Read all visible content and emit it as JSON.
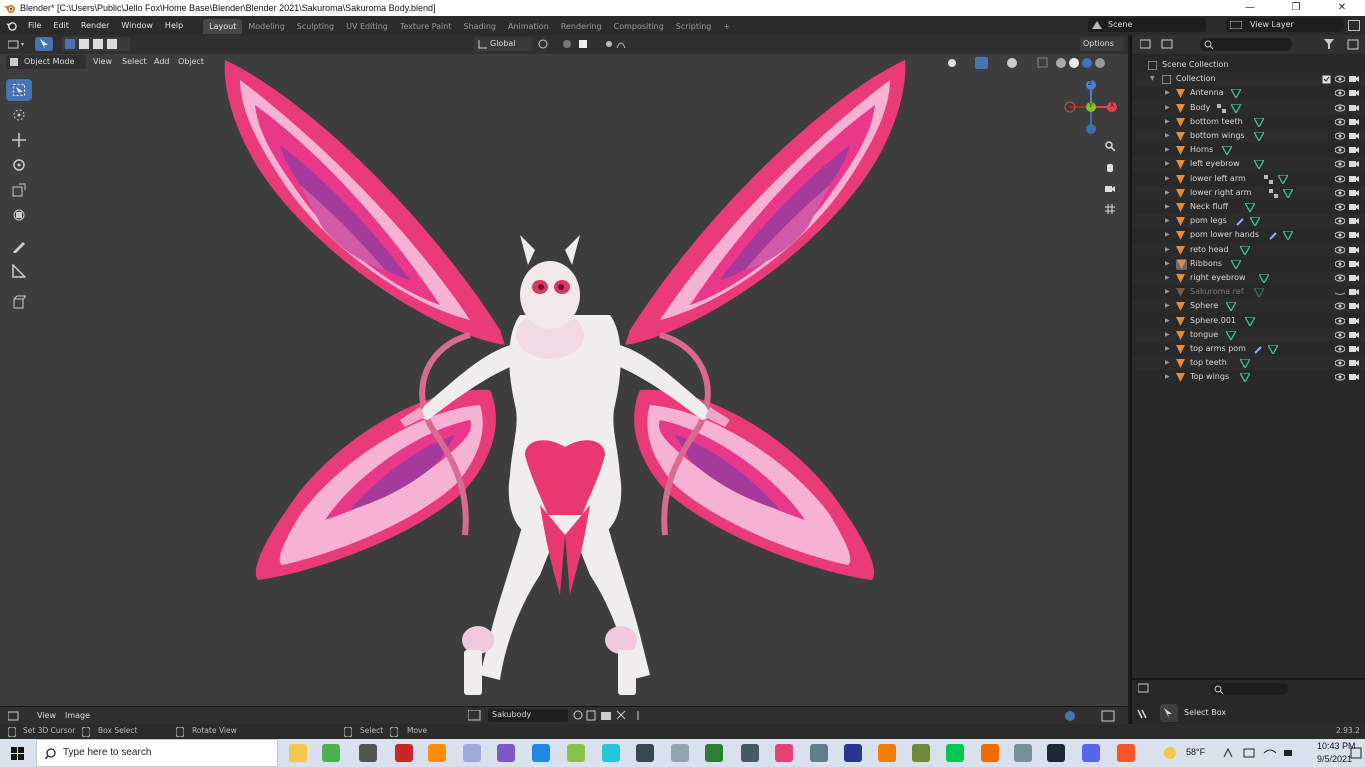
{
  "window": {
    "title": "Blender* [C:\\Users\\Public\\Jello Fox\\Home Base\\Blender\\Blender 2021\\Sakuroma\\Sakuroma Body.blend]",
    "minimize": "—",
    "restore": "❐",
    "close": "✕"
  },
  "menus": [
    "File",
    "Edit",
    "Render",
    "Window",
    "Help"
  ],
  "workspaces": [
    "Layout",
    "Modeling",
    "Sculpting",
    "UV Editing",
    "Texture Paint",
    "Shading",
    "Animation",
    "Rendering",
    "Compositing",
    "Scripting"
  ],
  "workspace_add": "+",
  "active_workspace": "Layout",
  "scene": {
    "label": "Scene",
    "view_layer": "View Layer"
  },
  "viewport": {
    "mode": "Object Mode",
    "menus": [
      "View",
      "Select",
      "Add",
      "Object"
    ],
    "orientation": "Global",
    "options": "Options",
    "gizmo_axes": {
      "x": "X",
      "y": "Y",
      "z": "Z"
    }
  },
  "outliner": {
    "root": "Scene Collection",
    "collection": "Collection",
    "items": [
      {
        "name": "Antenna",
        "dim": false,
        "mods": "none"
      },
      {
        "name": "Body",
        "dim": false,
        "mods": "armature"
      },
      {
        "name": "bottom teeth",
        "dim": false,
        "mods": "none"
      },
      {
        "name": "bottom wings",
        "dim": false,
        "mods": "none"
      },
      {
        "name": "Horns",
        "dim": false,
        "mods": "none"
      },
      {
        "name": "left eyebrow",
        "dim": false,
        "mods": "none"
      },
      {
        "name": "lower left arm",
        "dim": false,
        "mods": "armature"
      },
      {
        "name": "lower right arm",
        "dim": false,
        "mods": "armature"
      },
      {
        "name": "Neck fluff",
        "dim": false,
        "mods": "none"
      },
      {
        "name": "pom legs",
        "dim": false,
        "mods": "wrench"
      },
      {
        "name": "pom lower hands",
        "dim": false,
        "mods": "wrench"
      },
      {
        "name": "reto head",
        "dim": false,
        "mods": "none"
      },
      {
        "name": "Ribbons",
        "dim": false,
        "mods": "none"
      },
      {
        "name": "right eyebrow",
        "dim": false,
        "mods": "none"
      },
      {
        "name": "Sakuroma ref",
        "dim": true,
        "mods": "none"
      },
      {
        "name": "Sphere",
        "dim": false,
        "mods": "none"
      },
      {
        "name": "Sphere.001",
        "dim": false,
        "mods": "none"
      },
      {
        "name": "tongue",
        "dim": false,
        "mods": "none"
      },
      {
        "name": "top arms pom",
        "dim": false,
        "mods": "wrench"
      },
      {
        "name": "top teeth",
        "dim": false,
        "mods": "none"
      },
      {
        "name": "Top wings",
        "dim": false,
        "mods": "none"
      }
    ]
  },
  "properties": {
    "tool_name": "Select Box"
  },
  "image_editor": {
    "menus": [
      "View",
      "Image"
    ],
    "image_name": "Sakubody"
  },
  "statusbar": {
    "hints": [
      "Set 3D Cursor",
      "Box Select",
      "Rotate View",
      "Select",
      "Move"
    ],
    "version": "2.93.2"
  },
  "taskbar": {
    "search_placeholder": "Type here to search",
    "weather": "58°F",
    "time": "10:43 PM",
    "date": "9/5/2021"
  },
  "colors": {
    "accent": "#4772b3",
    "viewport_bg": "#3d3d3d",
    "wing_pink": "#e8336f",
    "wing_light": "#f0a6c8",
    "wing_purple": "#a43a9a",
    "body": "#efeded",
    "object_orange": "#e78a3c",
    "mesh_green": "#3fbf94"
  }
}
